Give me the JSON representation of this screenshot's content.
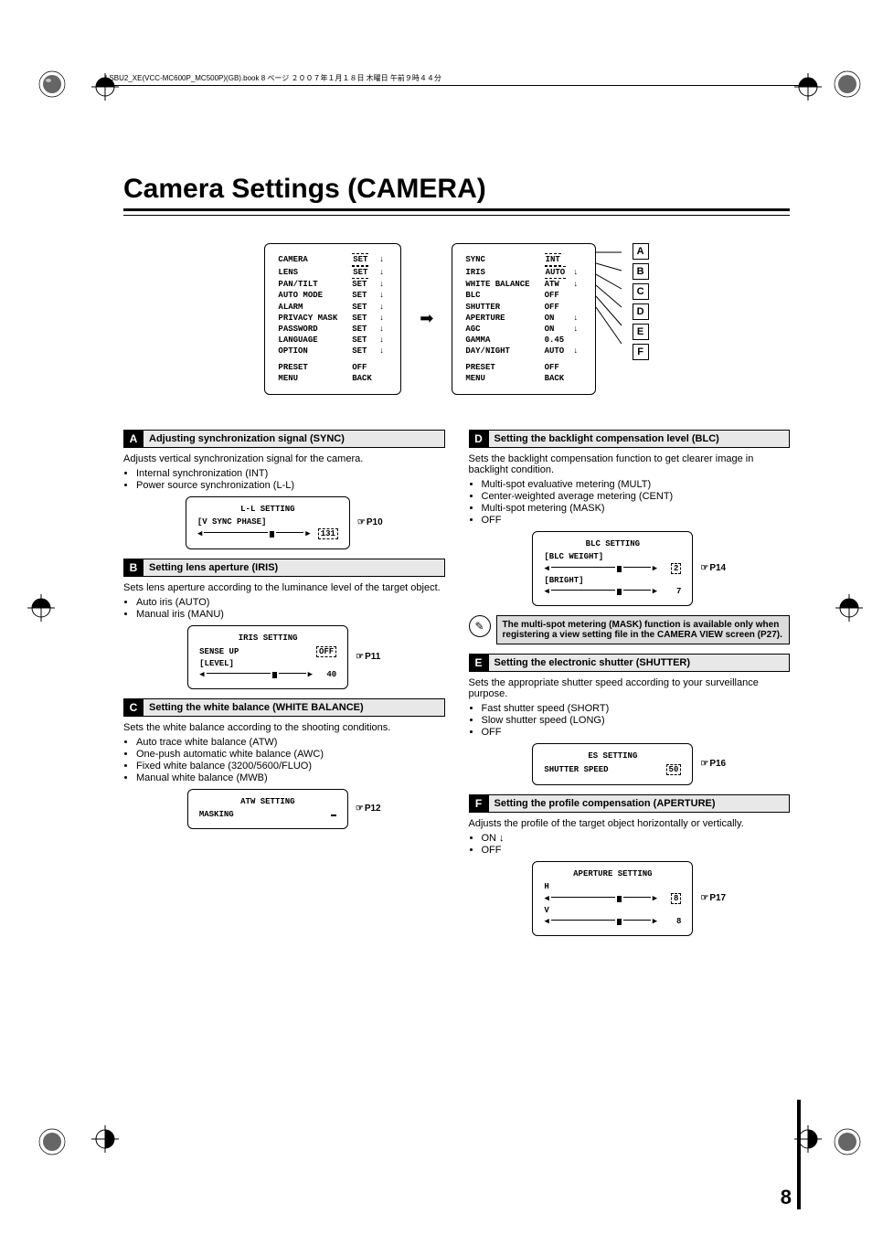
{
  "header_line": "LSBU2_XE(VCC-MC600P_MC500P)(GB).book  8 ページ  ２００７年１月１８日  木曜日  午前９時４４分",
  "page_title": "Camera Settings (CAMERA)",
  "page_number": "8",
  "main_menu": {
    "rows": [
      {
        "label": "CAMERA",
        "val": "SET",
        "arrow": "↓",
        "dashed": true
      },
      {
        "label": "LENS",
        "val": "SET",
        "arrow": "↓",
        "dashed": true
      },
      {
        "label": "PAN/TILT",
        "val": "SET",
        "arrow": "↓"
      },
      {
        "label": "AUTO MODE",
        "val": "SET",
        "arrow": "↓"
      },
      {
        "label": "ALARM",
        "val": "SET",
        "arrow": "↓"
      },
      {
        "label": "PRIVACY MASK",
        "val": "SET",
        "arrow": "↓"
      },
      {
        "label": "PASSWORD",
        "val": "SET",
        "arrow": "↓"
      },
      {
        "label": "LANGUAGE",
        "val": "SET",
        "arrow": "↓"
      },
      {
        "label": "OPTION",
        "val": "SET",
        "arrow": "↓"
      }
    ],
    "footer": [
      {
        "label": "PRESET",
        "val": "OFF"
      },
      {
        "label": "MENU",
        "val": "BACK"
      }
    ]
  },
  "camera_menu": {
    "rows": [
      {
        "label": "SYNC",
        "val": "INT",
        "dashed": true,
        "callout": "A"
      },
      {
        "label": "IRIS",
        "val": "AUTO",
        "arrow": "↓",
        "dashed": true,
        "callout": "B"
      },
      {
        "label": "WHITE BALANCE",
        "val": "ATW",
        "arrow": "↓",
        "callout": "C"
      },
      {
        "label": "BLC",
        "val": "OFF",
        "callout": "D"
      },
      {
        "label": "SHUTTER",
        "val": "OFF",
        "callout": "E"
      },
      {
        "label": "APERTURE",
        "val": "ON",
        "arrow": "↓",
        "callout": "F"
      },
      {
        "label": "AGC",
        "val": "ON",
        "arrow": "↓"
      },
      {
        "label": "GAMMA",
        "val": "0.45"
      },
      {
        "label": "DAY/NIGHT",
        "val": "AUTO",
        "arrow": "↓"
      }
    ],
    "footer": [
      {
        "label": "PRESET",
        "val": "OFF"
      },
      {
        "label": "MENU",
        "val": "BACK"
      }
    ]
  },
  "sections": {
    "A": {
      "title": "Adjusting synchronization signal (SYNC)",
      "lead": "Adjusts vertical synchronization signal for the camera.",
      "bullets": [
        "Internal synchronization (INT)",
        "Power source synchronization (L-L)"
      ],
      "osd_title": "L-L SETTING",
      "osd_rows": [
        {
          "label": "[V SYNC PHASE]",
          "value": "131",
          "slider": true,
          "dashed": true
        }
      ],
      "ref": "P10"
    },
    "B": {
      "title": "Setting lens aperture (IRIS)",
      "lead": "Sets lens aperture according to the luminance level of the target object.",
      "bullets": [
        "Auto iris (AUTO)",
        "Manual iris (MANU)"
      ],
      "osd_title": "IRIS SETTING",
      "osd_rows": [
        {
          "label": "SENSE UP",
          "value": "OFF",
          "dashed": true
        },
        {
          "label": "[LEVEL]",
          "value": "40",
          "slider": true
        }
      ],
      "ref": "P11"
    },
    "C": {
      "title": "Setting the white balance (WHITE BALANCE)",
      "lead": "Sets the white balance according to the shooting conditions.",
      "bullets": [
        "Auto trace white balance (ATW)",
        "One-push automatic white balance (AWC)",
        "Fixed white balance (3200/5600/FLUO)",
        "Manual white balance (MWB)"
      ],
      "osd_title": "ATW SETTING",
      "osd_rows": [
        {
          "label": "MASKING",
          "value": "",
          "dashed": true
        }
      ],
      "ref": "P12"
    },
    "D": {
      "title": "Setting the backlight compensation level (BLC)",
      "lead": "Sets the backlight compensation function to get clearer image in backlight condition.",
      "bullets": [
        "Multi-spot evaluative metering (MULT)",
        "Center-weighted average metering (CENT)",
        "Multi-spot metering (MASK)",
        "OFF"
      ],
      "osd_title": "BLC SETTING",
      "osd_rows": [
        {
          "label": "[BLC WEIGHT]",
          "value": "2",
          "slider": true,
          "dashed": true
        },
        {
          "label": "[BRIGHT]",
          "value": "7",
          "slider": true
        }
      ],
      "ref": "P14",
      "note": "The multi-spot metering (MASK) function is available only when registering a view setting file in the CAMERA VIEW screen (P27)."
    },
    "E": {
      "title": "Setting the electronic shutter (SHUTTER)",
      "lead": "Sets the appropriate shutter speed according to your surveillance purpose.",
      "bullets": [
        "Fast shutter speed (SHORT)",
        "Slow shutter speed (LONG)",
        "OFF"
      ],
      "osd_title": "ES SETTING",
      "osd_rows": [
        {
          "label": "SHUTTER SPEED",
          "value": "50",
          "dashed": true
        }
      ],
      "ref": "P16"
    },
    "F": {
      "title": "Setting the profile compensation (APERTURE)",
      "lead": "Adjusts the profile of the target object horizontally or vertically.",
      "bullets": [
        "ON ↓",
        "OFF"
      ],
      "osd_title": "APERTURE SETTING",
      "osd_rows": [
        {
          "label": "H",
          "value": "8",
          "slider": true,
          "dashed": true
        },
        {
          "label": "V",
          "value": "8",
          "slider": true
        }
      ],
      "ref": "P17"
    }
  }
}
